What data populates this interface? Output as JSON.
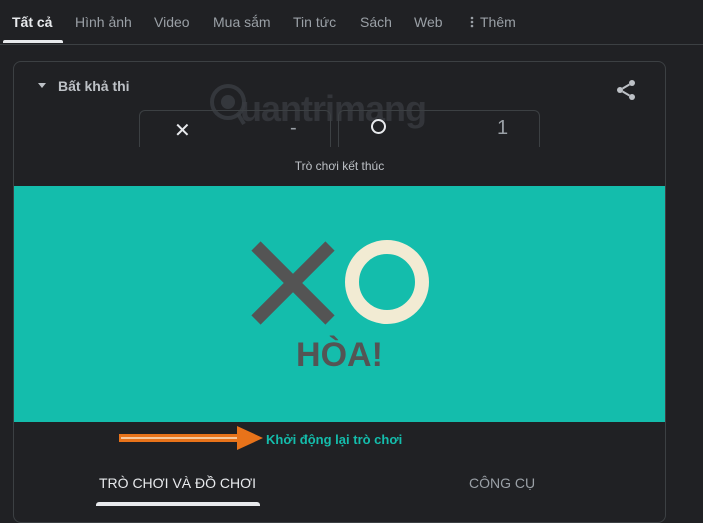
{
  "tabs": [
    {
      "label": "Tất cả"
    },
    {
      "label": "Hình ảnh"
    },
    {
      "label": "Video"
    },
    {
      "label": "Mua sắm"
    },
    {
      "label": "Tin tức"
    },
    {
      "label": "Sách"
    },
    {
      "label": "Web"
    },
    {
      "label": "Thêm"
    }
  ],
  "more_icon": "vertical-dots-icon",
  "game": {
    "level": "Bất khả thi",
    "share_icon": "share-icon",
    "player_x": {
      "mark": "✕",
      "score": "-"
    },
    "player_o": {
      "score": "1"
    },
    "status": "Trò chơi kết thúc",
    "result": "HÒA!",
    "restart": "Khởi động lại trò chơi"
  },
  "watermark": {
    "text": "uantrimang"
  },
  "bottom_tabs": [
    {
      "label": "TRÒ CHƠI VÀ ĐỒ CHƠI"
    },
    {
      "label": "CÔNG CỤ"
    }
  ],
  "colors": {
    "board": "#14bdac",
    "x_mark": "#545454",
    "o_mark": "#f2ebd3",
    "arrow": "#e8731a"
  }
}
